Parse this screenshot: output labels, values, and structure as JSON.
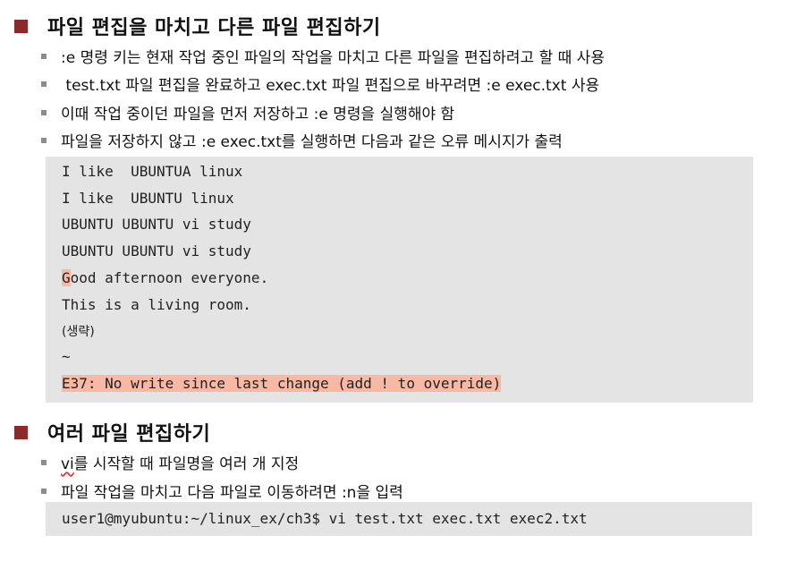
{
  "section1": {
    "title": "파일 편집을 마치고 다른 파일 편집하기",
    "bullets": [
      ":e 명령 키는 현재 작업 중인 파일의 작업을 마치고 다른 파일을 편집하려고 할 때 사용",
      " test.txt 파일 편집을 완료하고 exec.txt 파일 편집으로 바꾸려면 :e exec.txt 사용",
      "이때 작업 중이던 파일을 먼저 저장하고 :e 명령을 실행해야 함",
      "파일을 저장하지 않고 :e exec.txt를 실행하면 다음과 같은 오류 메시지가 출력"
    ],
    "terminal_lines": {
      "l1": "I like  UBUNTUA linux",
      "l2": "I like  UBUNTU linux",
      "l3": "UBUNTU UBUNTU vi study",
      "l4": "UBUNTU UBUNTU vi study",
      "l5_cursor": "G",
      "l5_rest": "ood afternoon everyone.",
      "l6": "This is a living room.",
      "l7": "(생략)",
      "l8": "~",
      "error": "E37: No write since last change (add ! to override)"
    }
  },
  "section2": {
    "title": "여러 파일 편집하기",
    "bullet1_vi": "vi",
    "bullet1_rest": "를 시작할 때 파일명을 여러 개 지정",
    "bullet2": "파일 작업을 마치고 다음 파일로 이동하려면 :n을 입력",
    "command": "user1@myubuntu:~/linux_ex/ch3$ vi test.txt exec.txt exec2.txt"
  },
  "colors": {
    "heading_square": "#8b2a2a",
    "bullet": "#8c8c8c",
    "code_background": "#e4e4e4",
    "highlight": "#f7b9a4"
  }
}
